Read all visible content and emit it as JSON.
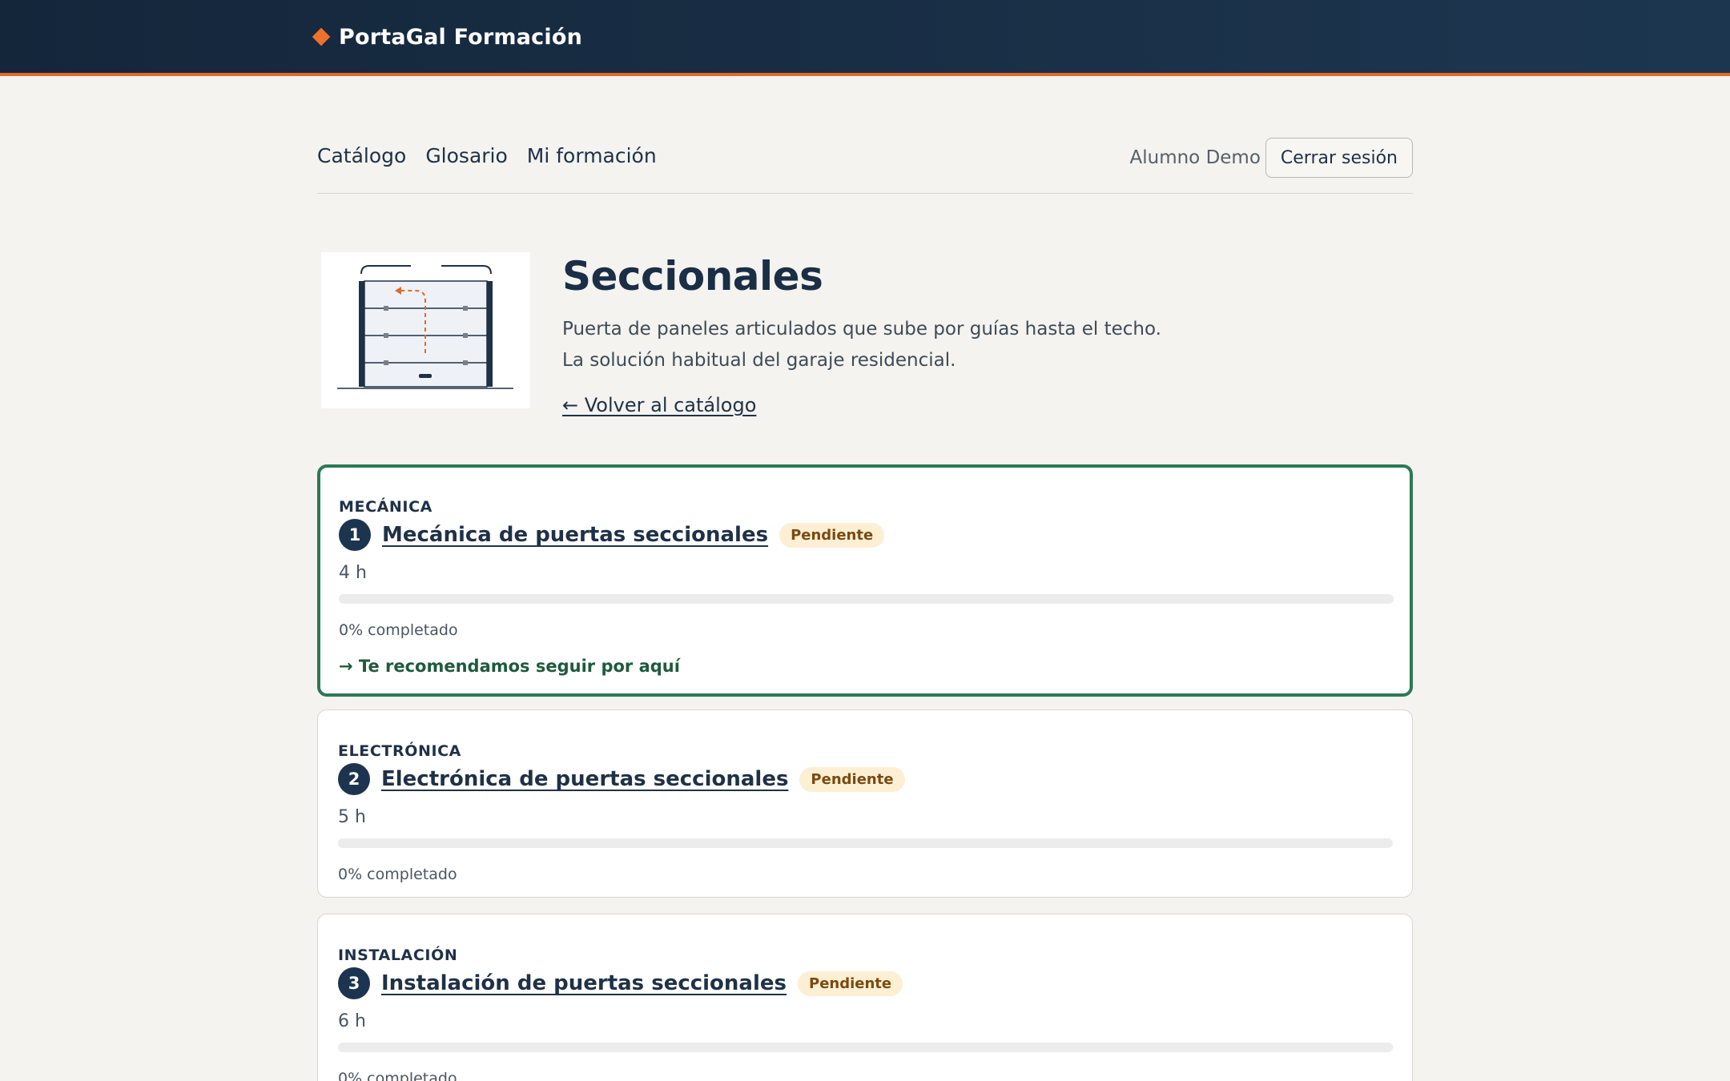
{
  "header": {
    "brand": "PortaGal Formación"
  },
  "nav": {
    "links": [
      "Catálogo",
      "Glosario",
      "Mi formación"
    ],
    "user_name": "Alumno Demo",
    "logout_label": "Cerrar sesión"
  },
  "hero": {
    "title": "Seccionales",
    "description": "Puerta de paneles articulados que sube por guías hasta el techo. La solución habitual del garaje residencial.",
    "back_link": "← Volver al catálogo",
    "image_icon": "sectional-door-illustration"
  },
  "courses": [
    {
      "category": "MECÁNICA",
      "number": "1",
      "title": "Mecánica de puertas seccionales",
      "status": "Pendiente",
      "hours": "4 h",
      "progress": 0,
      "progress_text": "0% completado",
      "recommendation": "→ Te recomendamos seguir por aquí"
    },
    {
      "category": "ELECTRÓNICA",
      "number": "2",
      "title": "Electrónica de puertas seccionales",
      "status": "Pendiente",
      "hours": "5 h",
      "progress": 0,
      "progress_text": "0% completado"
    },
    {
      "category": "INSTALACIÓN",
      "number": "3",
      "title": "Instalación de puertas seccionales",
      "status": "Pendiente",
      "hours": "6 h",
      "progress": 0,
      "progress_text": "0% completado"
    }
  ],
  "colors": {
    "header_bg": "#1a2f47",
    "accent_orange": "#e2692b",
    "recommended_green": "#2a7a54",
    "badge_bg": "#fcefd3"
  }
}
